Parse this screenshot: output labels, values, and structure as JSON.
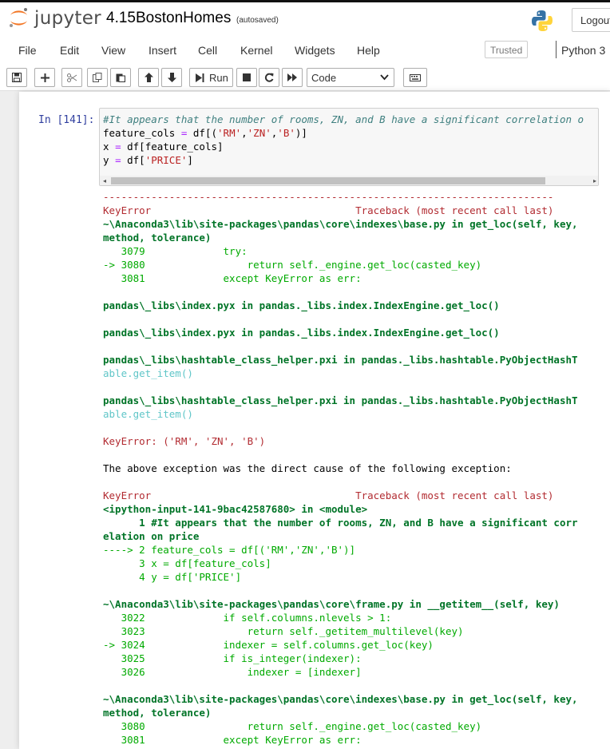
{
  "header": {
    "logo_text": "jupyter",
    "notebook_name": "4.15BostonHomes",
    "autosave": "(autosaved)",
    "logout_label": "Logout"
  },
  "menubar": {
    "items": [
      "File",
      "Edit",
      "View",
      "Insert",
      "Cell",
      "Kernel",
      "Widgets",
      "Help"
    ],
    "trusted_label": "Trusted",
    "kernel_name": "Python 3"
  },
  "toolbar": {
    "run_label": "Run",
    "cell_type": "Code"
  },
  "cell": {
    "prompt": "In [141]:",
    "code": [
      "#It appears that the number of rooms, ZN, and B have a significant correlation o",
      "feature_cols = df[('RM','ZN','B')]",
      "x = df[feature_cols]",
      "y = df['PRICE']"
    ]
  },
  "output": {
    "separator": "---------------------------------------------------------------------------",
    "lines": [
      "KeyError                                  Traceback (most recent call last)",
      "~\\Anaconda3\\lib\\site-packages\\pandas\\core\\indexes\\base.py in get_loc(self, key,",
      "method, tolerance)",
      "   3079             try:",
      "-> 3080                 return self._engine.get_loc(casted_key)",
      "   3081             except KeyError as err:",
      "",
      "pandas\\_libs\\index.pyx in pandas._libs.index.IndexEngine.get_loc()",
      "",
      "pandas\\_libs\\index.pyx in pandas._libs.index.IndexEngine.get_loc()",
      "",
      "pandas\\_libs\\hashtable_class_helper.pxi in pandas._libs.hashtable.PyObjectHashT",
      "able.get_item()",
      "",
      "pandas\\_libs\\hashtable_class_helper.pxi in pandas._libs.hashtable.PyObjectHashT",
      "able.get_item()",
      "",
      "KeyError: ('RM', 'ZN', 'B')",
      "",
      "The above exception was the direct cause of the following exception:",
      "",
      "KeyError                                  Traceback (most recent call last)",
      "<ipython-input-141-9bac42587680> in <module>",
      "      1 #It appears that the number of rooms, ZN, and B have a significant corr",
      "elation on price",
      "----> 2 feature_cols = df[('RM','ZN','B')]",
      "      3 x = df[feature_cols]",
      "      4 y = df['PRICE']",
      "",
      "~\\Anaconda3\\lib\\site-packages\\pandas\\core\\frame.py in __getitem__(self, key)",
      "   3022             if self.columns.nlevels > 1:",
      "   3023                 return self._getitem_multilevel(key)",
      "-> 3024             indexer = self.columns.get_loc(key)",
      "   3025             if is_integer(indexer):",
      "   3026                 indexer = [indexer]",
      "",
      "~\\Anaconda3\\lib\\site-packages\\pandas\\core\\indexes\\base.py in get_loc(self, key,",
      "method, tolerance)",
      "   3080                 return self._engine.get_loc(casted_key)",
      "   3081             except KeyError as err:"
    ]
  }
}
